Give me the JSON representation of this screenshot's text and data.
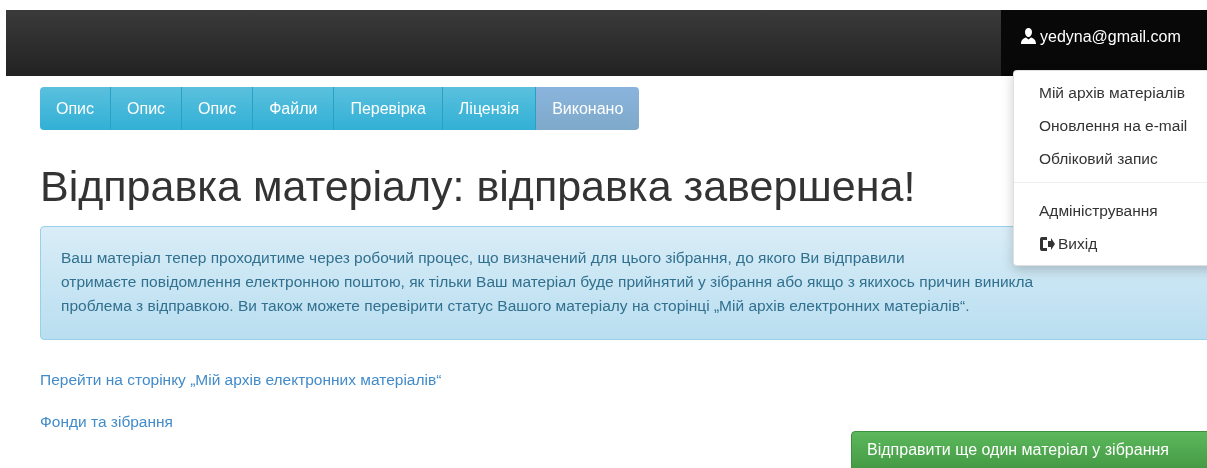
{
  "navbar": {
    "user_email": "yedyna@gmail.com"
  },
  "user_menu": {
    "groups": [
      {
        "items": [
          "Мій архів матеріалів",
          "Оновлення на e-mail",
          "Обліковий запис"
        ]
      },
      {
        "items": [
          "Адміністрування",
          "Вихід"
        ]
      }
    ]
  },
  "progress_steps": [
    {
      "label": "Опис",
      "selected": false
    },
    {
      "label": "Опис",
      "selected": false
    },
    {
      "label": "Опис",
      "selected": false
    },
    {
      "label": "Файли",
      "selected": false
    },
    {
      "label": "Перевірка",
      "selected": false
    },
    {
      "label": "Ліцензія",
      "selected": false
    },
    {
      "label": "Виконано",
      "selected": true
    }
  ],
  "heading": "Відправка матеріалу: відправка завершена!",
  "alert_lines": [
    "Ваш матеріал тепер проходитиме через робочий процес, що визначений для цього зібрання, до якого Ви відправили",
    "отримаєте повідомлення електронною поштою, як тільки Ваш матеріал буде прийнятий у зібрання або якщо з якихось причин виникла",
    "проблема з відправкою. Ви також можете перевірити статус Вашого матеріалу на сторінці „Мій архів електронних матеріалів“."
  ],
  "links": [
    "Перейти на сторінку „Мій архів електронних матеріалів“",
    "Фонди та зібрання"
  ],
  "submit_button": "Відправити ще один матеріал у зібрання"
}
